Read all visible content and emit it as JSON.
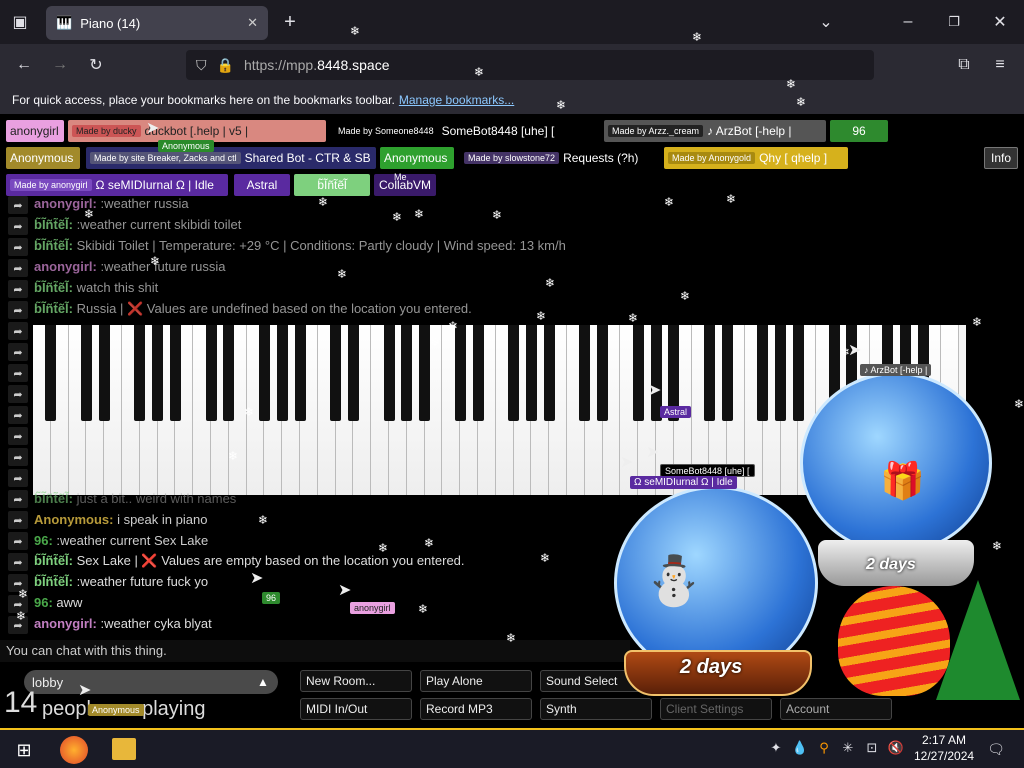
{
  "browser": {
    "tab_title": "Piano (14)",
    "url_prefix": "https://mpp.",
    "url_domain": "8448.space",
    "bookmarks_text": "For quick access, place your bookmarks here on the bookmarks toolbar.",
    "bookmarks_link": "Manage bookmarks..."
  },
  "users": [
    {
      "label": "anonygirl",
      "bg": "#e9a0e0",
      "fg": "#222"
    },
    {
      "sub": "Made by ducky",
      "label": "duckbot [.help | v5 |",
      "bg": "#d98880",
      "fg": "#222"
    },
    {
      "sub": "Made by Someone8448",
      "label": "SomeBot8448 [uhe] [",
      "bg": "#000",
      "fg": "#fff"
    },
    {
      "sub": "Made by Arzz._cream",
      "label": "♪ ArzBot [-help |",
      "bg": "#555",
      "fg": "#fff"
    },
    {
      "label": "96",
      "bg": "#2e8a2e",
      "fg": "#fff"
    },
    {
      "label": "Anonymous",
      "bg": "#a28a2a",
      "fg": "#fff"
    },
    {
      "sub": "Made by site Breaker, Zacks and ctl",
      "label": "Shared Bot - CTR & SB",
      "bg": "#2a2a6a",
      "fg": "#fff"
    },
    {
      "label": "Anonymous",
      "bg": "#2ea02e",
      "fg": "#fff"
    },
    {
      "sub": "Made by slowstone72",
      "label": "Requests (?h)",
      "bg": "#000",
      "fg": "#fff"
    },
    {
      "sub": "Made by Anonygold",
      "label": "Qhy [ qhelp ]",
      "bg": "#d6b11c",
      "fg": "#fff"
    },
    {
      "sub": "Made by anonygirl",
      "label": "Ω seMIDIurnal Ω | Idle",
      "bg": "#5a2aa0",
      "fg": "#fff"
    },
    {
      "label": "Astral",
      "bg": "#5a2aa0",
      "fg": "#fff"
    },
    {
      "label": "b̃Ĩñt̃ẽl̃",
      "bg": "#7ed07e",
      "fg": "#fff"
    },
    {
      "label": "CollabVM",
      "bg": "#3a1a6a",
      "fg": "#fff"
    }
  ],
  "info_button": "Info",
  "anonymous_badge": "Anonymous",
  "me_badge": "Me",
  "chat_top": [
    {
      "name": "anonygirl:",
      "color": "#c27fc2",
      "msg": ":weather russia"
    },
    {
      "name": "b̃Ĩñt̃ẽl̃:",
      "color": "#7ed07e",
      "msg": ":weather current skibidi toilet"
    },
    {
      "name": "b̃Ĩñt̃ẽl̃:",
      "color": "#7ed07e",
      "msg": "Skibidi Toilet | Temperature: +29 °C | Conditions: Partly cloudy | Wind speed: 13 km/h"
    },
    {
      "name": "anonygirl:",
      "color": "#c27fc2",
      "msg": ":weather future russia"
    },
    {
      "name": "b̃Ĩñt̃ẽl̃:",
      "color": "#7ed07e",
      "msg": "watch this shit"
    },
    {
      "name": "b̃Ĩñt̃ẽl̃:",
      "color": "#7ed07e",
      "msg": "Russia | ❌ Values are undefined based on the location you entered."
    }
  ],
  "chat_bottom": [
    {
      "name": "b̃Ĩñt̃ẽl̃:",
      "color": "#7ed07e",
      "msg": "just a bit.. weird with names"
    },
    {
      "name": "Anonymous:",
      "color": "#b79a3a",
      "msg": "i speak in piano"
    },
    {
      "name": "96:",
      "color": "#4aa84a",
      "msg": ":weather current Sex Lake"
    },
    {
      "name": "b̃Ĩñt̃ẽl̃:",
      "color": "#7ed07e",
      "msg": "Sex Lake | ❌ Values are empty based on the location you entered."
    },
    {
      "name": "b̃Ĩñt̃ẽl̃:",
      "color": "#7ed07e",
      "msg": ":weather future fuck yo"
    },
    {
      "name": "96:",
      "color": "#4aa84a",
      "msg": "aww"
    },
    {
      "name": "anonygirl:",
      "color": "#c27fc2",
      "msg": ":weather cyka blyat"
    }
  ],
  "chat_placeholder": "You can chat with this thing.",
  "room": {
    "name": "lobby",
    "count": "14",
    "people_text": "people are playing"
  },
  "buttons": {
    "new_room": "New Room...",
    "play_alone": "Play Alone",
    "sound_select": "Sound Select",
    "midi": "MIDI In/Out",
    "record": "Record MP3",
    "synth": "Synth",
    "client_settings": "Client Settings",
    "account": "Account"
  },
  "cursor_labels": {
    "astral": "Astral",
    "somebot": "SomeBot8448 [uhe] [",
    "semidiurnal": "Ω seMIDIurnal Ω | Idle",
    "n96": "96",
    "anonygirl": "anonygirl",
    "arzbot": "♪ ArzBot [-help |",
    "anonymous": "Anonymous"
  },
  "globe_text_1": "2 days",
  "globe_text_2": "2 days",
  "clock": {
    "time": "2:17 AM",
    "date": "12/27/2024"
  }
}
